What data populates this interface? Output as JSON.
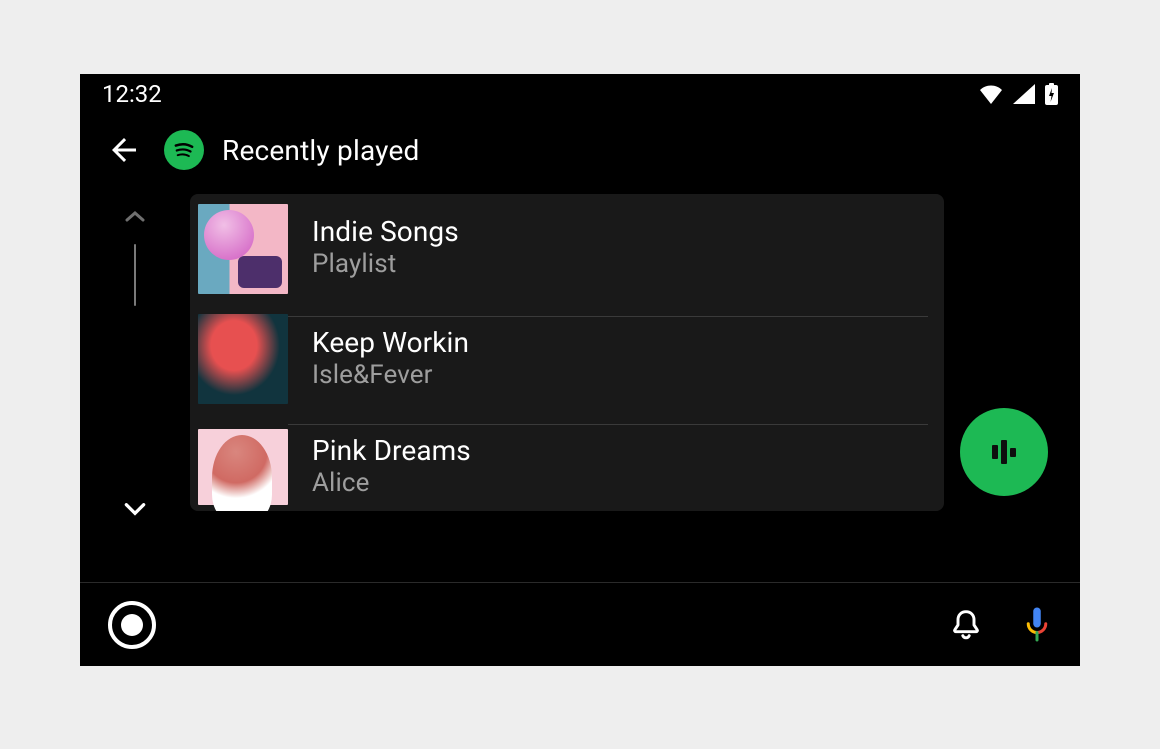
{
  "status": {
    "time": "12:32"
  },
  "header": {
    "title": "Recently played"
  },
  "list": [
    {
      "title": "Indie Songs",
      "subtitle": "Playlist"
    },
    {
      "title": "Keep Workin",
      "subtitle": "Isle&Fever"
    },
    {
      "title": "Pink Dreams",
      "subtitle": "Alice"
    }
  ],
  "icons": {
    "back": "back-arrow-icon",
    "app": "spotify-icon",
    "fab": "equalizer-icon",
    "launcher": "launcher-icon",
    "bell": "notifications-icon",
    "mic": "google-mic-icon",
    "wifi": "wifi-icon",
    "signal": "cell-signal-icon",
    "battery": "battery-charging-icon",
    "scrollUp": "chevron-up-icon",
    "scrollDown": "chevron-down-icon"
  }
}
